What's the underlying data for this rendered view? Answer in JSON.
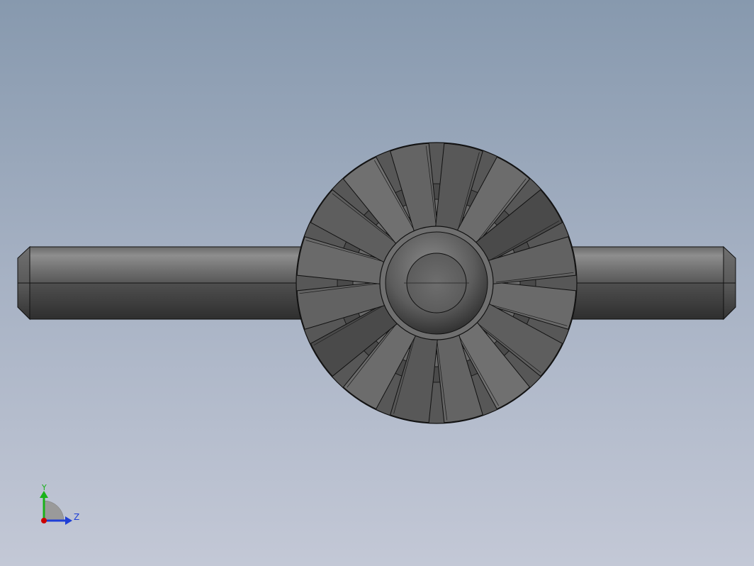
{
  "model": {
    "part": "shaft-with-radial-impeller",
    "blade_count": 16
  },
  "triad": {
    "y_label": "Y",
    "z_label": "Z",
    "x_color": "#cc0000",
    "y_color": "#19b219",
    "z_color": "#1f3fd6"
  },
  "colors": {
    "background_top": "#8799ae",
    "background_bottom": "#c3c8d6",
    "body": "#5a5a5a",
    "edge": "#111111"
  }
}
